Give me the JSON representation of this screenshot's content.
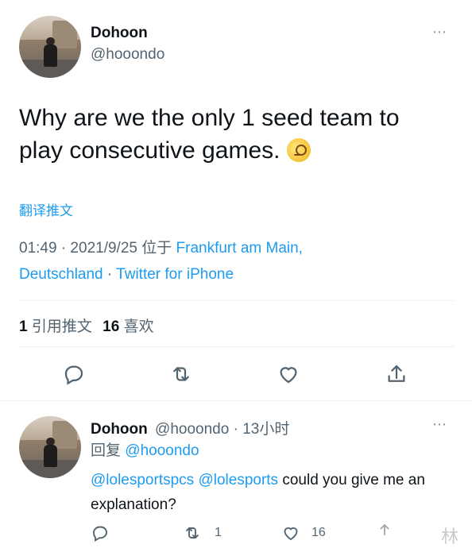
{
  "tweet": {
    "display_name": "Dohoon",
    "handle": "@hooondo",
    "more_icon": "⋯",
    "text": "Why are we the only 1 seed team to play consecutive games.",
    "emoji": "face-with-monocle",
    "translate_label": "翻译推文",
    "time": "01:49 · 2021/9/25 位于 ",
    "location": "Frankfurt am Main, Deutschland",
    "separator": " · ",
    "source": "Twitter for iPhone",
    "retweets_count": "1",
    "retweets_label": "引用推文",
    "likes_count": "16",
    "likes_label": "喜欢",
    "actions": [
      "reply-icon",
      "retweet-icon",
      "like-icon",
      "share-icon"
    ]
  },
  "reply": {
    "display_name": "Dohoon",
    "handle_time": "@hooondo · 13小时",
    "more_icon": "⋯",
    "replying_prefix": "回复 ",
    "replying_to": "@hooondo",
    "mentions": "@lolesportspcs @lolesports",
    "text_rest": " could you give me an explanation?",
    "retweet_count": "1",
    "like_count": "16"
  },
  "watermark": "林",
  "colors": {
    "accent": "#1d9bf0",
    "text": "#0f1419",
    "muted": "#536471"
  }
}
